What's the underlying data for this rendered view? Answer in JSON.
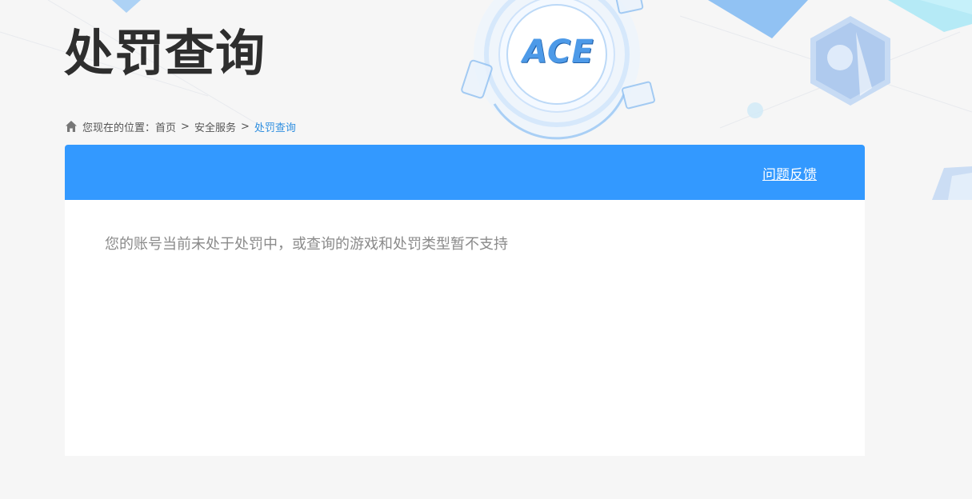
{
  "header": {
    "title": "处罚查询",
    "logo_text": "ACE"
  },
  "breadcrumb": {
    "prefix": "您现在的位置：",
    "items": [
      {
        "label": "首页"
      },
      {
        "label": "安全服务"
      }
    ],
    "separator": ">",
    "current": "处罚查询"
  },
  "panel": {
    "feedback_label": "问题反馈",
    "notice": "您的账号当前未处于处罚中，或查询的游戏和处罚类型暂不支持"
  },
  "colors": {
    "accent": "#3399ff",
    "breadcrumb_current": "#2f8fe0",
    "notice_text": "#8a8a8a",
    "page_bg": "#f6f6f6"
  }
}
